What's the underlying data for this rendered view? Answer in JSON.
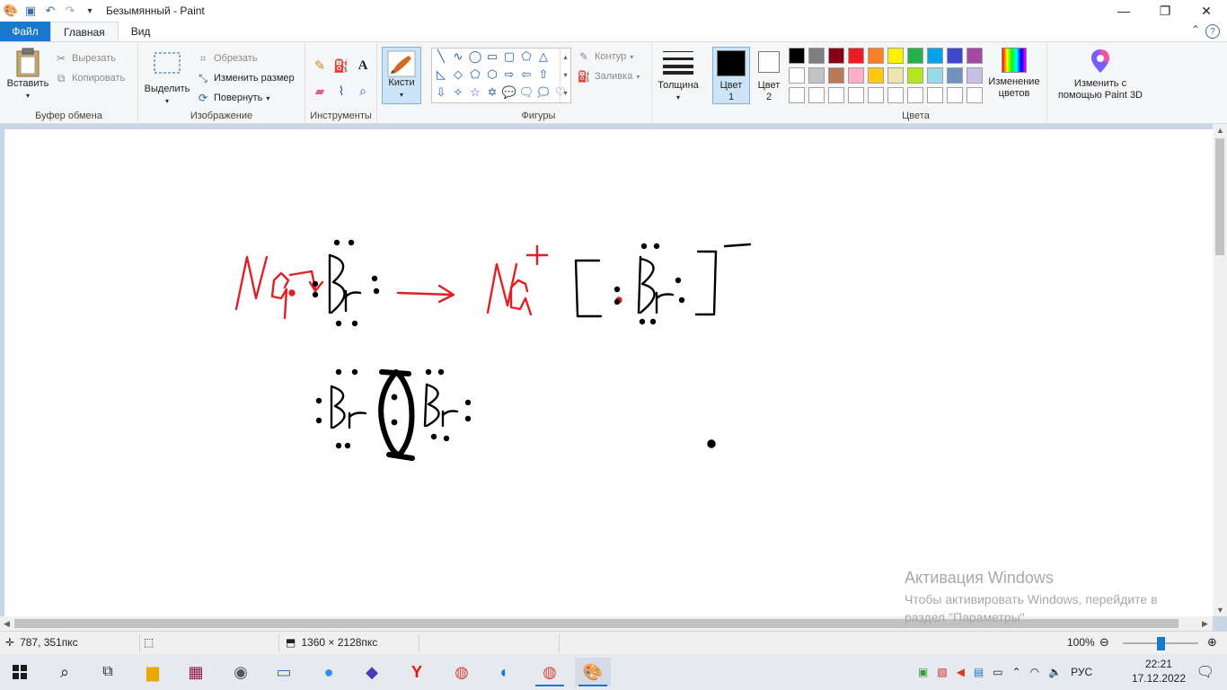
{
  "window": {
    "title": "Безымянный - Paint",
    "quick_access": [
      "save-icon",
      "undo-icon",
      "redo-icon",
      "customize-icon"
    ],
    "controls": [
      "minimize-icon",
      "maximize-icon",
      "close-icon"
    ]
  },
  "tabs": {
    "file": "Файл",
    "home": "Главная",
    "view": "Вид"
  },
  "ribbon": {
    "clipboard": {
      "label": "Буфер обмена",
      "paste": "Вставить",
      "cut": "Вырезать",
      "copy": "Копировать"
    },
    "image": {
      "label": "Изображение",
      "select": "Выделить",
      "crop": "Обрезать",
      "resize": "Изменить размер",
      "rotate": "Повернуть"
    },
    "tools": {
      "label": "Инструменты",
      "items": [
        "pencil-icon",
        "fill-icon",
        "text-icon",
        "eraser-icon",
        "color-picker-icon",
        "magnifier-icon"
      ],
      "text_glyph": "A"
    },
    "brushes": {
      "label": "Кисти"
    },
    "shapes": {
      "label": "Фигуры",
      "outline": "Контур",
      "fill": "Заливка",
      "glyphs": [
        "╲",
        "∿",
        "◯",
        "▭",
        "▢",
        "⬠",
        "△",
        "◺",
        "◇",
        "⬠",
        "⬡",
        "⇨",
        "⇦",
        "⇧",
        "⇩",
        "✧",
        "☆",
        "✡",
        "💬",
        "🗨",
        "🗯",
        "♡"
      ]
    },
    "thickness": {
      "label": "Толщина"
    },
    "color1": {
      "label": "Цвет 1",
      "color": "#000000"
    },
    "color2": {
      "label": "Цвет 2",
      "color": "#ffffff"
    },
    "colors": {
      "label": "Цвета",
      "row1": [
        "#000000",
        "#7f7f7f",
        "#880015",
        "#ed1c24",
        "#ff7f27",
        "#fff200",
        "#22b14c",
        "#00a2e8",
        "#3f48cc",
        "#a349a4"
      ],
      "row2": [
        "#ffffff",
        "#c3c3c3",
        "#b97a57",
        "#ffaec9",
        "#ffc90e",
        "#efe4b0",
        "#b5e61d",
        "#99d9ea",
        "#7092be",
        "#c8bfe7"
      ],
      "row3": [
        "#ffffff",
        "#ffffff",
        "#ffffff",
        "#ffffff",
        "#ffffff",
        "#ffffff",
        "#ffffff",
        "#ffffff",
        "#ffffff",
        "#ffffff"
      ]
    },
    "edit_colors": "Изменение цветов",
    "paint3d": "Изменить с помощью Paint 3D"
  },
  "drawing": {
    "stroke_color": "#000000",
    "red_color": "#e31e24"
  },
  "watermark": {
    "title": "Активация Windows",
    "text": "Чтобы активировать Windows, перейдите в раздел \"Параметры\"."
  },
  "status": {
    "cursor": "787, 351пкс",
    "size": "1360 × 2128пкс",
    "zoom": "100%",
    "zoom_level": 1.0
  },
  "taskbar": {
    "apps": [
      "windows-start-icon",
      "search-icon",
      "task-view-icon",
      "file-explorer-icon",
      "winrar-icon",
      "camera-icon",
      "remote-desktop-icon",
      "zoom-icon",
      "app-icon",
      "yandex-icon",
      "chrome-icon",
      "edge-icon",
      "chrome-profile-icon",
      "paint-icon"
    ],
    "lang": "РУС",
    "time": "22:21",
    "date": "17.12.2022"
  }
}
